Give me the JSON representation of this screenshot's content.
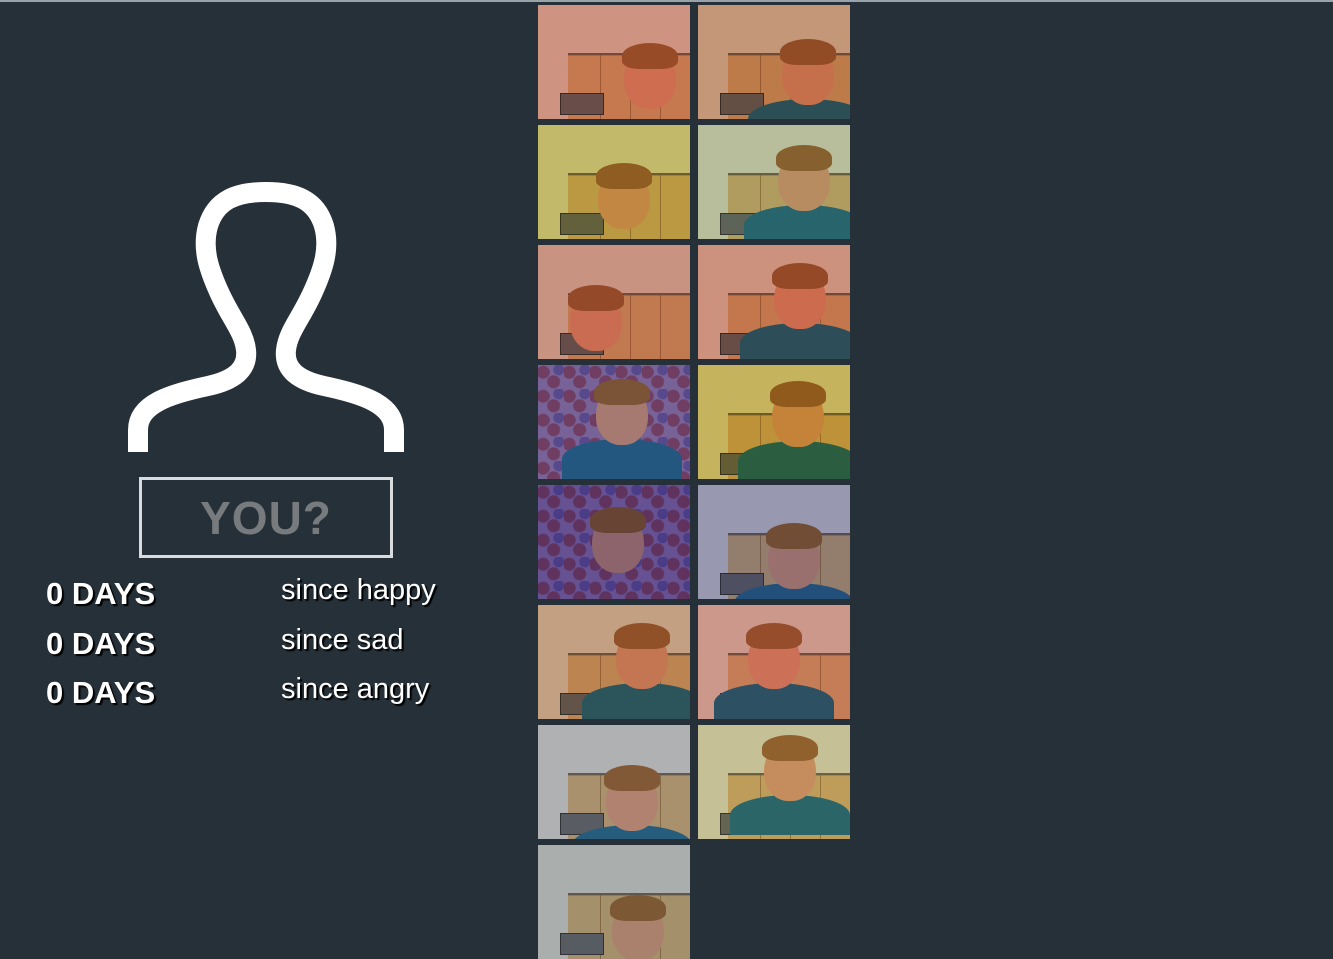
{
  "profile": {
    "avatar_icon": "person-silhouette-icon",
    "name_placeholder": "YOU?"
  },
  "stats": [
    {
      "count": "0 DAYS",
      "label": "since happy"
    },
    {
      "count": "0 DAYS",
      "label": "since sad"
    },
    {
      "count": "0 DAYS",
      "label": "since angry"
    }
  ],
  "gallery": {
    "photo_count": 15
  },
  "colors": {
    "background": "#263038",
    "text": "#ffffff",
    "name_box_border": "#d9dcde",
    "name_placeholder": "#777b7e"
  }
}
